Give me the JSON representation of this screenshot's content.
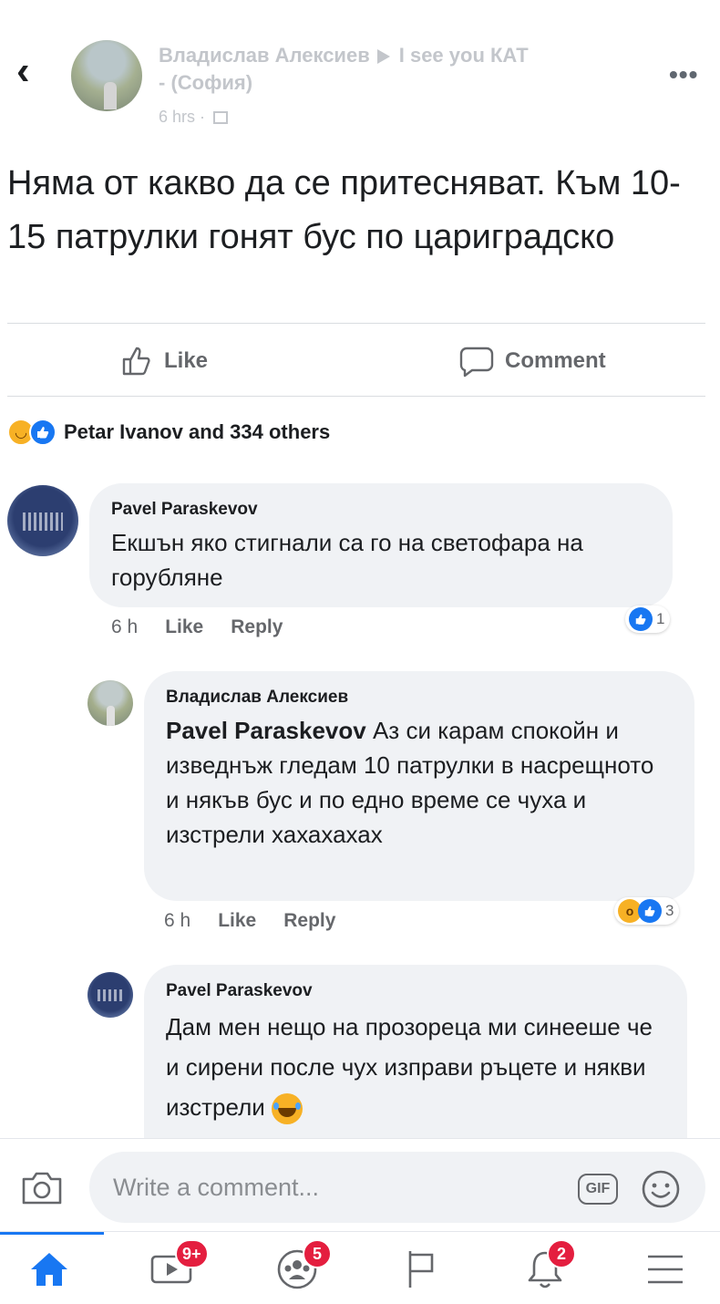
{
  "header": {
    "back_icon": "back-arrow-icon",
    "author": "Владислав Алексиев",
    "group": "I see you КАТ",
    "group_suffix": "- (София)",
    "time": "6 hrs ·",
    "more_icon": "more-dots-icon"
  },
  "post": {
    "text": "Няма от какво да се притесняват. Към 10-15 патрулки гонят бус по цариградско"
  },
  "actions": {
    "like_label": "Like",
    "comment_label": "Comment"
  },
  "reactions": {
    "summary": "Petar Ivanov and 334 others",
    "icons": [
      "haha-reaction-icon",
      "like-reaction-icon"
    ]
  },
  "comments": [
    {
      "author": "Pavel Paraskevov",
      "text": "Екшън яко стигнали са го на светофара на горубляне",
      "time": "6 h",
      "like_label": "Like",
      "reply_label": "Reply",
      "reaction_count": "1"
    },
    {
      "author": "Владислав Алексиев",
      "mention": "Pavel Paraskevov",
      "text": " Аз си карам спокойн и изведнъж гледам 10 патрулки в насрещното и някъв бус и по едно време се чуха и изстрели хахахахах",
      "time": "6 h",
      "like_label": "Like",
      "reply_label": "Reply",
      "reaction_count": "3"
    },
    {
      "author": "Pavel Paraskevov",
      "text": "Дам мен нещо на прозореца ми синееше че и сирени после чух изправи ръцете и някви изстрели",
      "emoji": "laughing-emoji"
    }
  ],
  "write_comment": {
    "placeholder": "Write a comment...",
    "gif_label": "GIF"
  },
  "nav": {
    "items": [
      {
        "icon": "home-icon",
        "badge": ""
      },
      {
        "icon": "watch-video-icon",
        "badge": "9+"
      },
      {
        "icon": "groups-icon",
        "badge": "5"
      },
      {
        "icon": "pages-flag-icon",
        "badge": ""
      },
      {
        "icon": "notifications-bell-icon",
        "badge": "2"
      },
      {
        "icon": "menu-icon",
        "badge": ""
      }
    ]
  },
  "colors": {
    "accent": "#1877f2",
    "badge_red": "#e41e3f",
    "bubble_bg": "#f0f2f5",
    "muted_text": "#65676b"
  }
}
